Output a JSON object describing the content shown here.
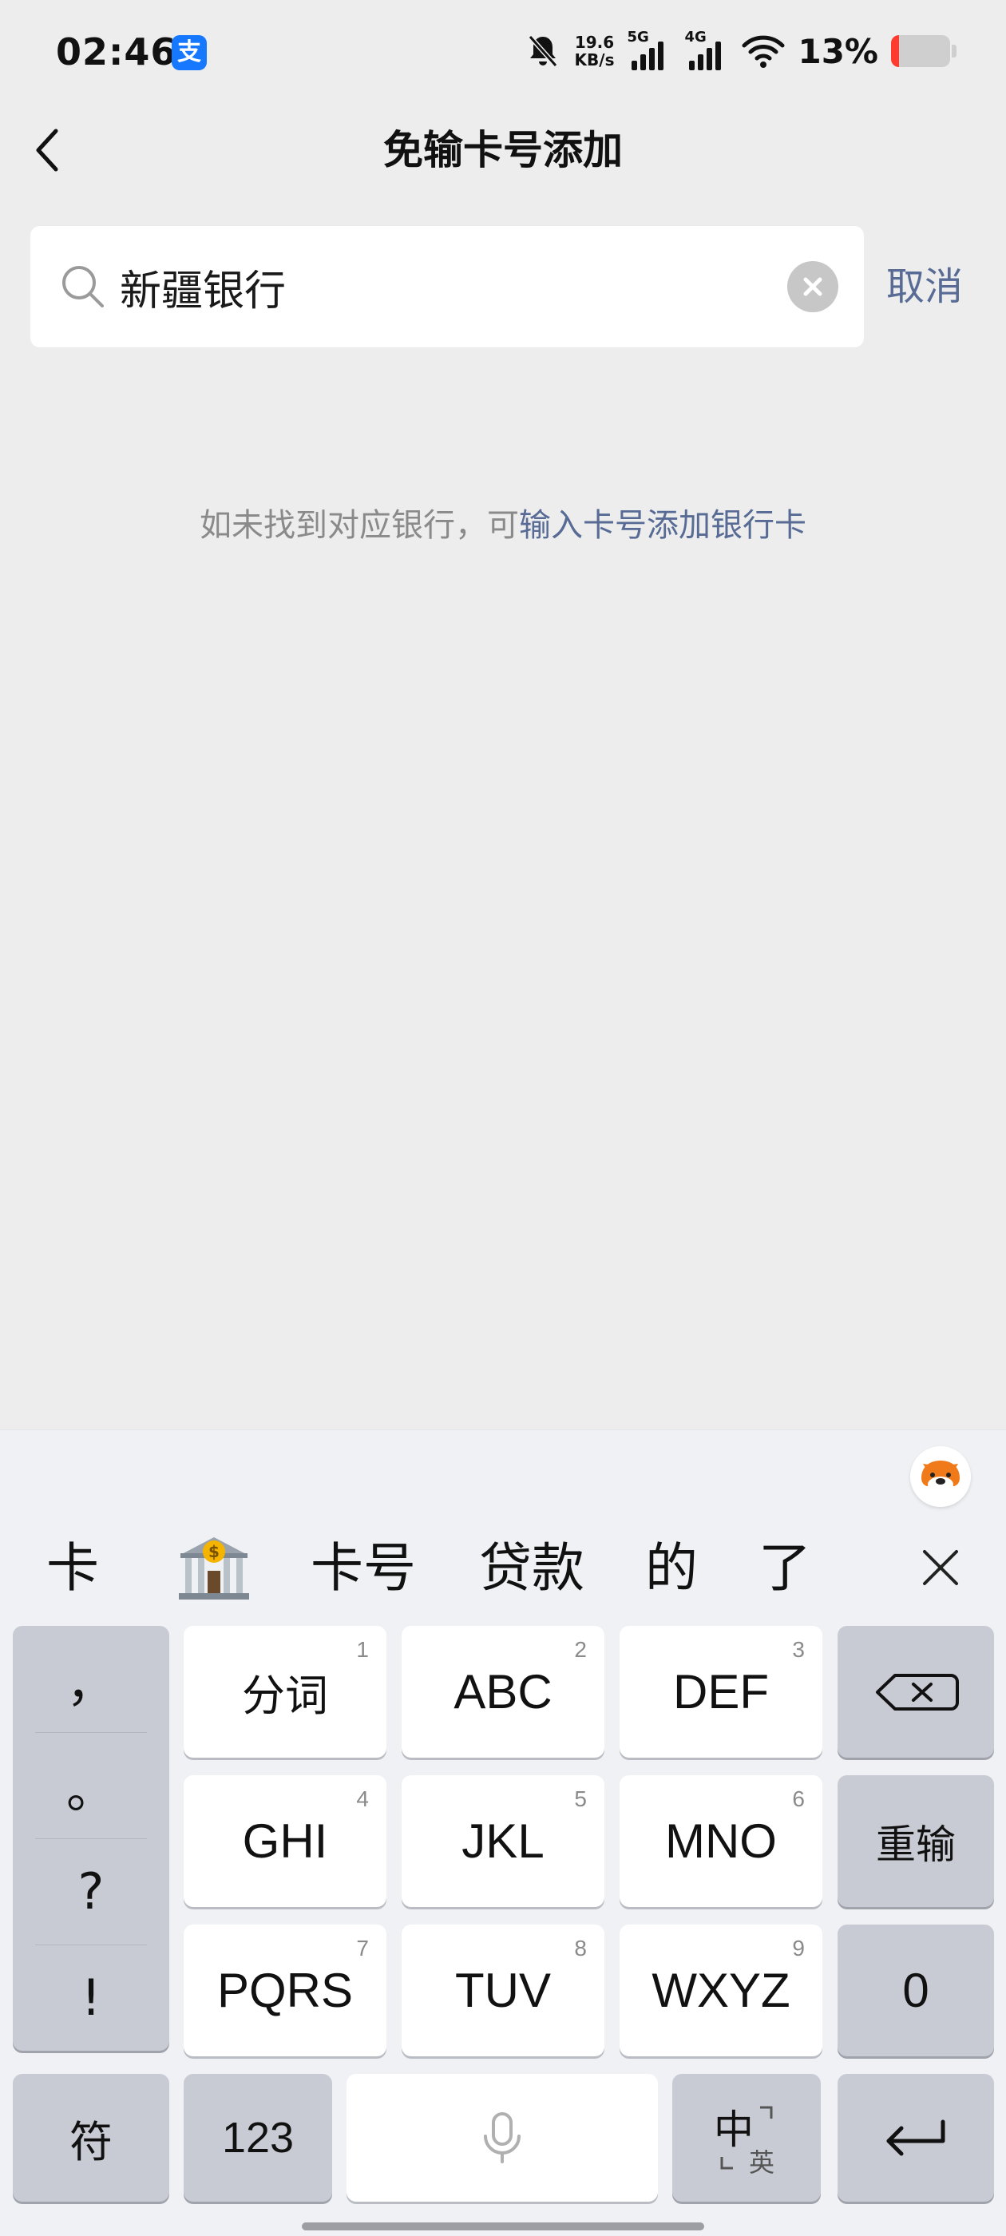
{
  "status_bar": {
    "time": "02:46",
    "alipay_badge": "支",
    "net_speed_value": "19.6",
    "net_speed_unit": "KB/s",
    "sim1": "5G",
    "sim2": "4G",
    "battery_percent": "13%",
    "battery_level": 0.13
  },
  "nav": {
    "title": "免输卡号添加"
  },
  "search": {
    "value": "新疆银行",
    "cancel_label": "取消"
  },
  "hint": {
    "text": "如未找到对应银行，可",
    "link": "输入卡号添加银行卡"
  },
  "keyboard": {
    "candidates": [
      "卡",
      "卡号",
      "贷款",
      "的",
      "了"
    ],
    "bank_emoji_icon": "bank-icon",
    "punctuation": [
      "，",
      "。",
      "?",
      "!"
    ],
    "keys": {
      "fenci": {
        "label": "分词",
        "num": "1"
      },
      "abc": {
        "label": "ABC",
        "num": "2"
      },
      "def": {
        "label": "DEF",
        "num": "3"
      },
      "ghi": {
        "label": "GHI",
        "num": "4"
      },
      "jkl": {
        "label": "JKL",
        "num": "5"
      },
      "mno": {
        "label": "MNO",
        "num": "6"
      },
      "pqrs": {
        "label": "PQRS",
        "num": "7"
      },
      "tuv": {
        "label": "TUV",
        "num": "8"
      },
      "wxyz": {
        "label": "WXYZ",
        "num": "9"
      },
      "reenter": "重输",
      "zero": "0",
      "symbols": "符",
      "numbers": "123",
      "lang_main": "中",
      "lang_sub": "英"
    }
  }
}
